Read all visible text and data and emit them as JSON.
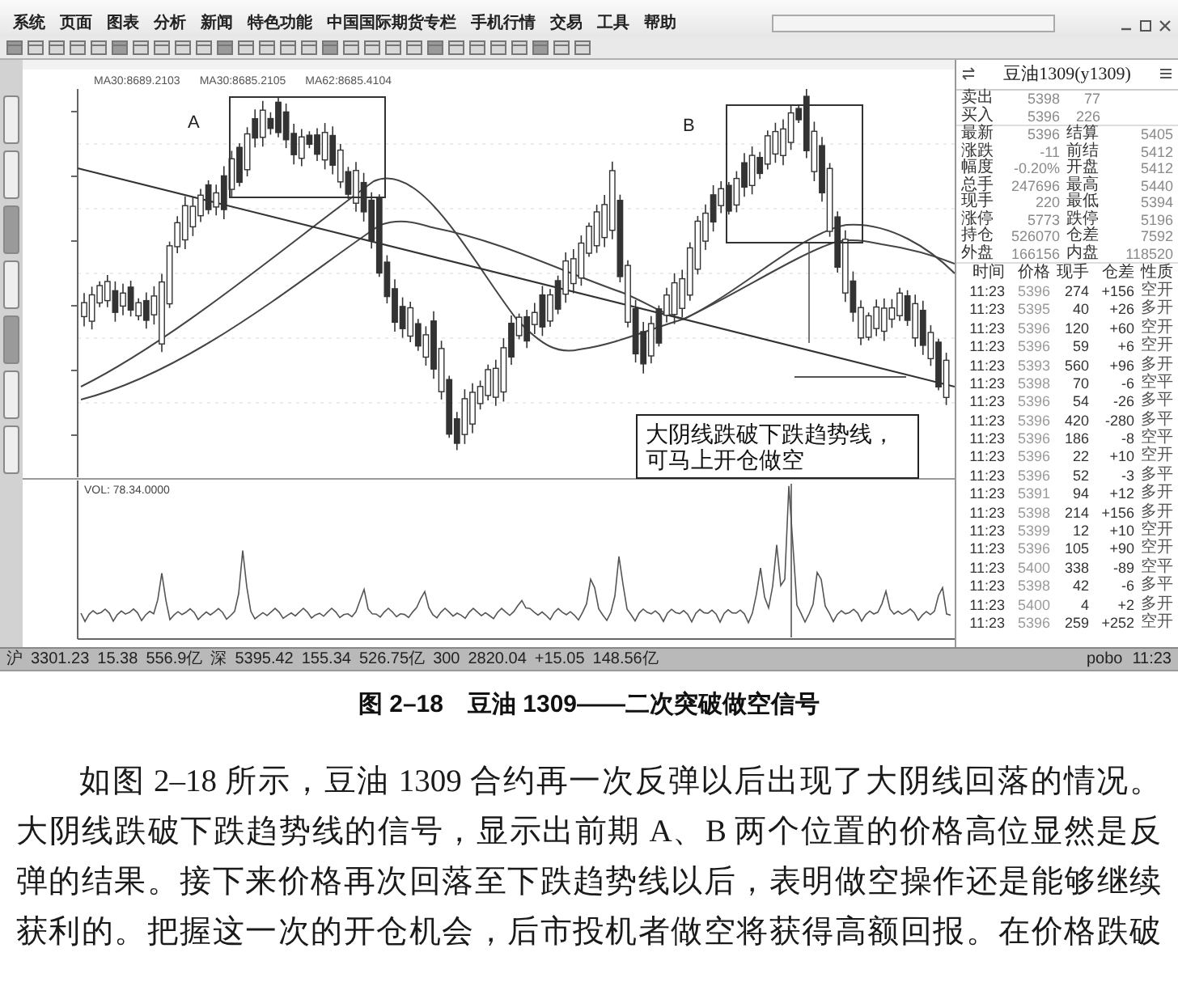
{
  "menu_bar": {
    "items": [
      "系统",
      "页面",
      "图表",
      "分析",
      "新闻",
      "特色功能",
      "中国国际期货专栏",
      "手机行情",
      "交易",
      "工具",
      "帮助"
    ]
  },
  "chart": {
    "ma_legend": [
      "MA30:8689.2103",
      "MA30:8685.2105",
      "MA62:8685.4104"
    ],
    "labels": [
      "A",
      "B"
    ],
    "annotation": "大阴线跌破下跌趋势线，可马上开仓做空"
  },
  "volume": {
    "legend": "VOL: 78.34.0000"
  },
  "quote_panel": {
    "title": "豆油1309(y1309)",
    "depth": [
      {
        "label": "卖出",
        "price": "5398",
        "volume": "77"
      },
      {
        "label": "买入",
        "price": "5396",
        "volume": "226"
      }
    ],
    "stats": [
      {
        "label": "最新",
        "value": "5396",
        "label_2": "结算",
        "value_2": "5405"
      },
      {
        "label": "涨跌",
        "value": "-11",
        "label_2": "前结",
        "value_2": "5412"
      },
      {
        "label": "幅度",
        "value": "-0.20%",
        "label_2": "开盘",
        "value_2": "5412"
      },
      {
        "label": "总手",
        "value": "247696",
        "label_2": "最高",
        "value_2": "5440"
      },
      {
        "label": "现手",
        "value": "220",
        "label_2": "最低",
        "value_2": "5394"
      },
      {
        "label": "涨停",
        "value": "5773",
        "label_2": "跌停",
        "value_2": "5196"
      },
      {
        "label": "持仓",
        "value": "526070",
        "label_2": "仓差",
        "value_2": "7592"
      },
      {
        "label": "外盘",
        "value": "166156",
        "label_2": "内盘",
        "value_2": "118520"
      }
    ],
    "trades_header": [
      "时间",
      "价格",
      "现手",
      "仓差",
      "性质"
    ],
    "trades": [
      {
        "time": "11:23",
        "price": "5396",
        "volume": "274",
        "change": "+156",
        "type": "空开"
      },
      {
        "time": "11:23",
        "price": "5395",
        "volume": "40",
        "change": "+26",
        "type": "多开"
      },
      {
        "time": "11:23",
        "price": "5396",
        "volume": "120",
        "change": "+60",
        "type": "空开"
      },
      {
        "time": "11:23",
        "price": "5396",
        "volume": "59",
        "change": "+6",
        "type": "空开"
      },
      {
        "time": "11:23",
        "price": "5393",
        "volume": "560",
        "change": "+96",
        "type": "多开"
      },
      {
        "time": "11:23",
        "price": "5398",
        "volume": "70",
        "change": "-6",
        "type": "空平"
      },
      {
        "time": "11:23",
        "price": "5396",
        "volume": "54",
        "change": "-26",
        "type": "多平"
      },
      {
        "time": "11:23",
        "price": "5396",
        "volume": "420",
        "change": "-280",
        "type": "多平"
      },
      {
        "time": "11:23",
        "price": "5396",
        "volume": "186",
        "change": "-8",
        "type": "空平"
      },
      {
        "time": "11:23",
        "price": "5396",
        "volume": "22",
        "change": "+10",
        "type": "空开"
      },
      {
        "time": "11:23",
        "price": "5396",
        "volume": "52",
        "change": "-3",
        "type": "多平"
      },
      {
        "time": "11:23",
        "price": "5391",
        "volume": "94",
        "change": "+12",
        "type": "多开"
      },
      {
        "time": "11:23",
        "price": "5398",
        "volume": "214",
        "change": "+156",
        "type": "多开"
      },
      {
        "time": "11:23",
        "price": "5399",
        "volume": "12",
        "change": "+10",
        "type": "空开"
      },
      {
        "time": "11:23",
        "price": "5396",
        "volume": "105",
        "change": "+90",
        "type": "空开"
      },
      {
        "time": "11:23",
        "price": "5400",
        "volume": "338",
        "change": "-89",
        "type": "空平"
      },
      {
        "time": "11:23",
        "price": "5398",
        "volume": "42",
        "change": "-6",
        "type": "多平"
      },
      {
        "time": "11:23",
        "price": "5400",
        "volume": "4",
        "change": "+2",
        "type": "多开"
      },
      {
        "time": "11:23",
        "price": "5396",
        "volume": "259",
        "change": "+252",
        "type": "空开"
      }
    ]
  },
  "status_bar": {
    "items": [
      "沪",
      "3301.23",
      "15.38",
      "556.9亿",
      "深",
      "5395.42",
      "155.34",
      "526.75亿",
      "300",
      "2820.04",
      "+15.05",
      "148.56亿"
    ],
    "right": [
      "pobo",
      "11:23"
    ]
  },
  "caption": "图 2–18　豆油 1309——二次突破做空信号",
  "paragraph": [
    "如图 2–18 所示，豆油 1309 合约再一次反弹以后出现了大阴线回落的情况。",
    "大阴线跌破下跌趋势线的信号，显示出前期 A、B 两个位置的价格高位显然是反",
    "弹的结果。接下来价格再次回落至下跌趋势线以后，表明做空操作还是能够继续",
    "获利的。把握这一次的开仓机会，后市投机者做空将获得高额回报。在价格跌破"
  ]
}
